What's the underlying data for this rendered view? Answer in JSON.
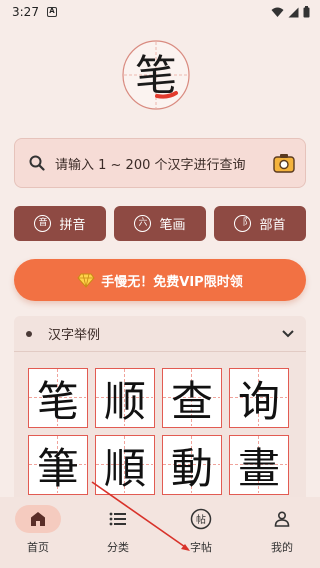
{
  "status_bar": {
    "time": "3:27",
    "notification": "A"
  },
  "logo": {
    "char": "笔"
  },
  "search": {
    "placeholder": "请输入 1 ~ 200 个汉字进行查询"
  },
  "categories": [
    {
      "icon_char": "音",
      "label": "拼音"
    },
    {
      "icon_char": "六",
      "label": "笔画"
    },
    {
      "icon_char": "⻏",
      "label": "部首"
    }
  ],
  "vip": {
    "label": "手慢无！免费VIP限时领"
  },
  "examples": {
    "title": "汉字举例",
    "rows": [
      [
        "笔",
        "顺",
        "查",
        "询"
      ],
      [
        "筆",
        "順",
        "動",
        "畫"
      ]
    ]
  },
  "nav": [
    {
      "label": "首页",
      "active": true
    },
    {
      "label": "分类",
      "active": false
    },
    {
      "label": "字帖",
      "active": false
    },
    {
      "label": "我的",
      "active": false
    }
  ],
  "colors": {
    "brand_brown": "#8e4a43",
    "vip_orange": "#f27143",
    "grid_red": "#e25b52",
    "background": "#f7ece8"
  }
}
